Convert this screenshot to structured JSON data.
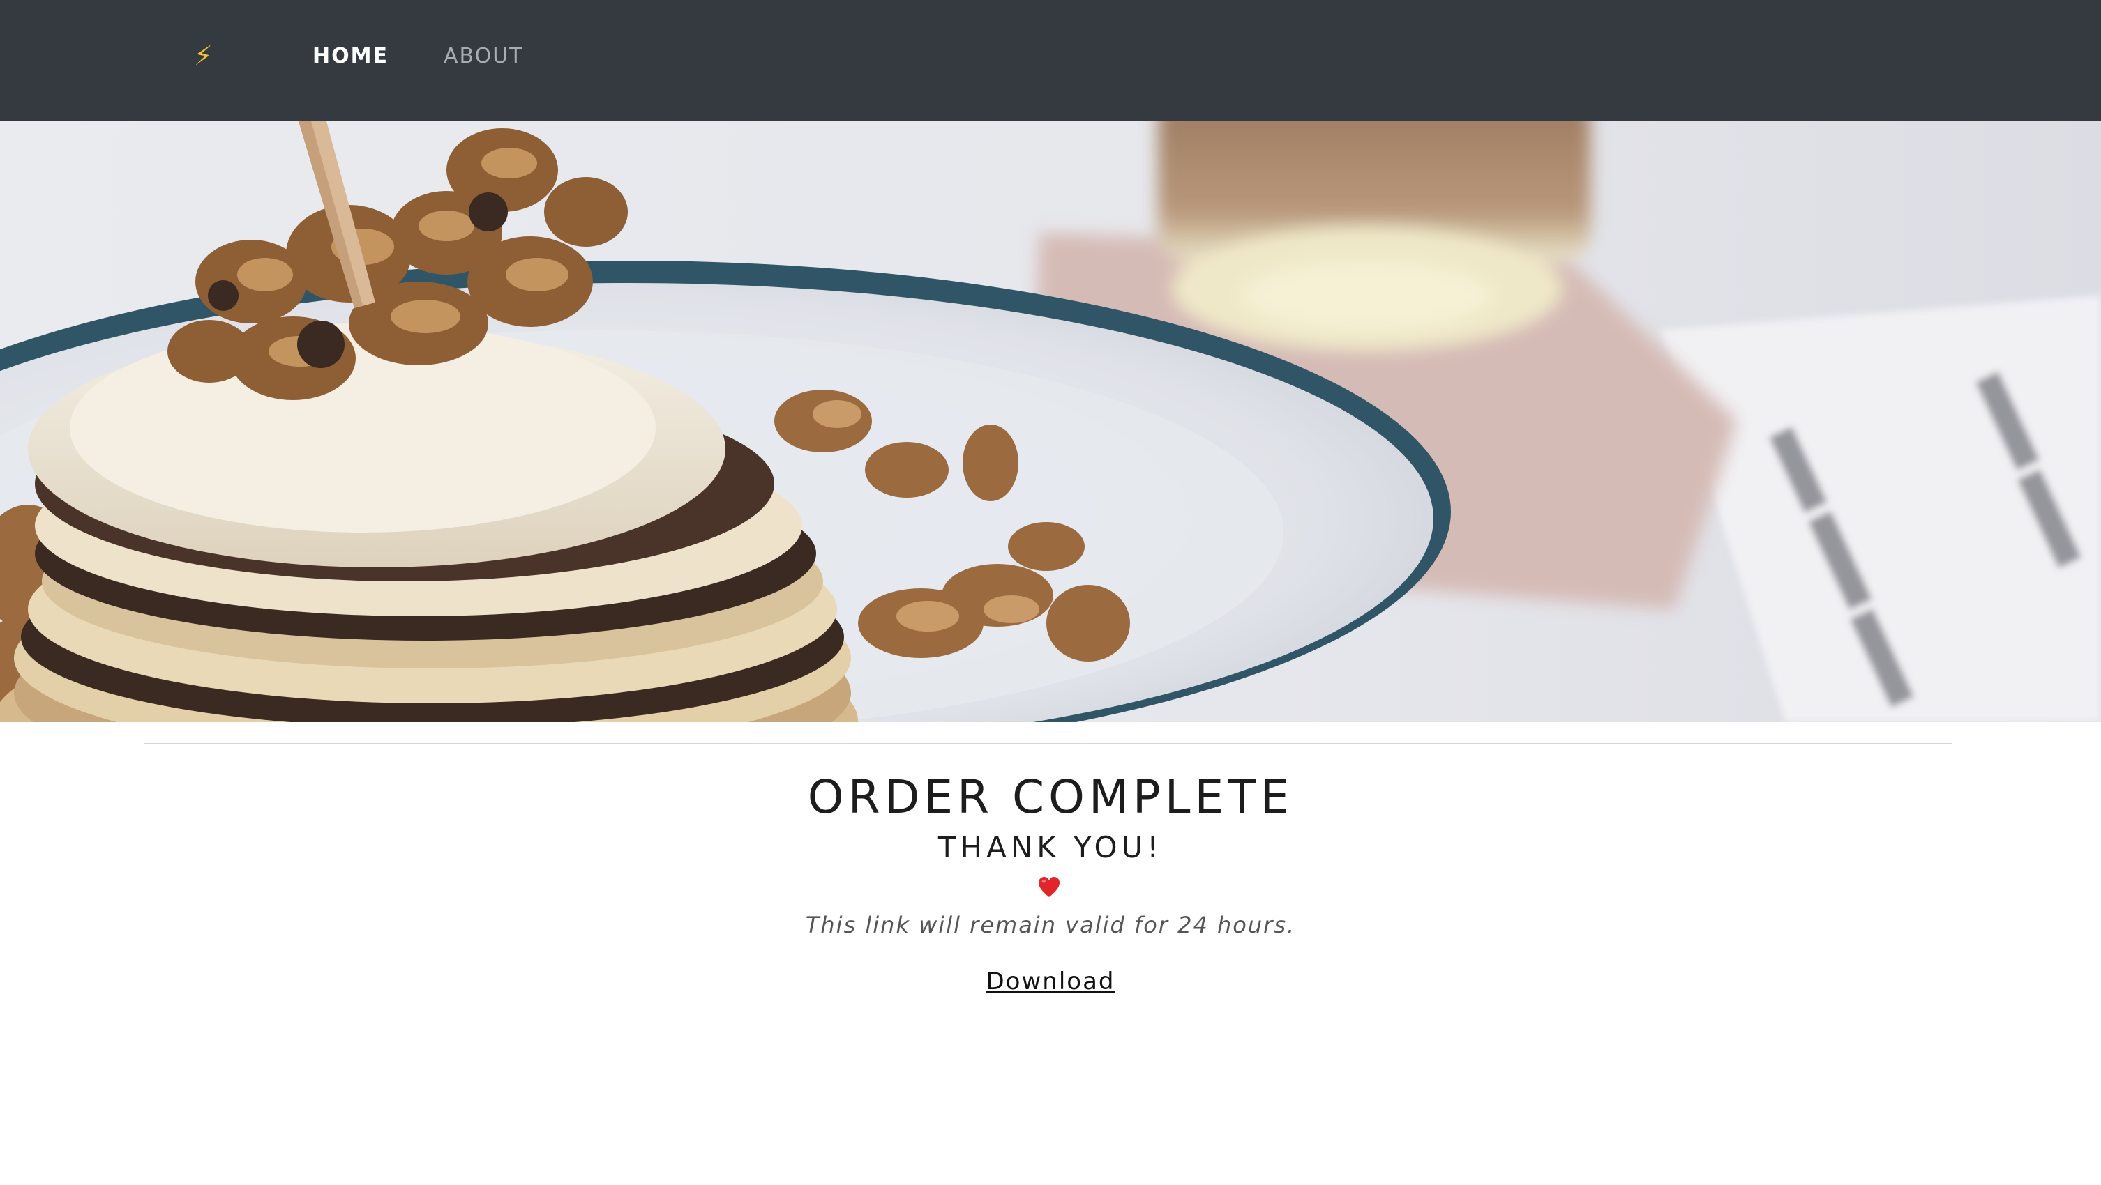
{
  "nav": {
    "brand_icon": "lightning-bolt-icon",
    "brand_glyph": "⚡",
    "items": [
      {
        "label": "HOME",
        "active": true
      },
      {
        "label": "ABOUT",
        "active": false
      }
    ]
  },
  "hero": {
    "image": "pancake stack with walnuts and coconut, coffee glass in background"
  },
  "main": {
    "title": "ORDER COMPLETE",
    "subtitle": "THANK YOU!",
    "heart_icon": "heart-icon",
    "note": "This link will remain valid for 24 hours.",
    "download_label": "Download"
  },
  "colors": {
    "navbar_bg": "#343a40",
    "brand_icon": "#f2c230",
    "nav_active": "#ffffff",
    "nav_inactive": "#a9adb1",
    "heart": "#e0262b"
  }
}
